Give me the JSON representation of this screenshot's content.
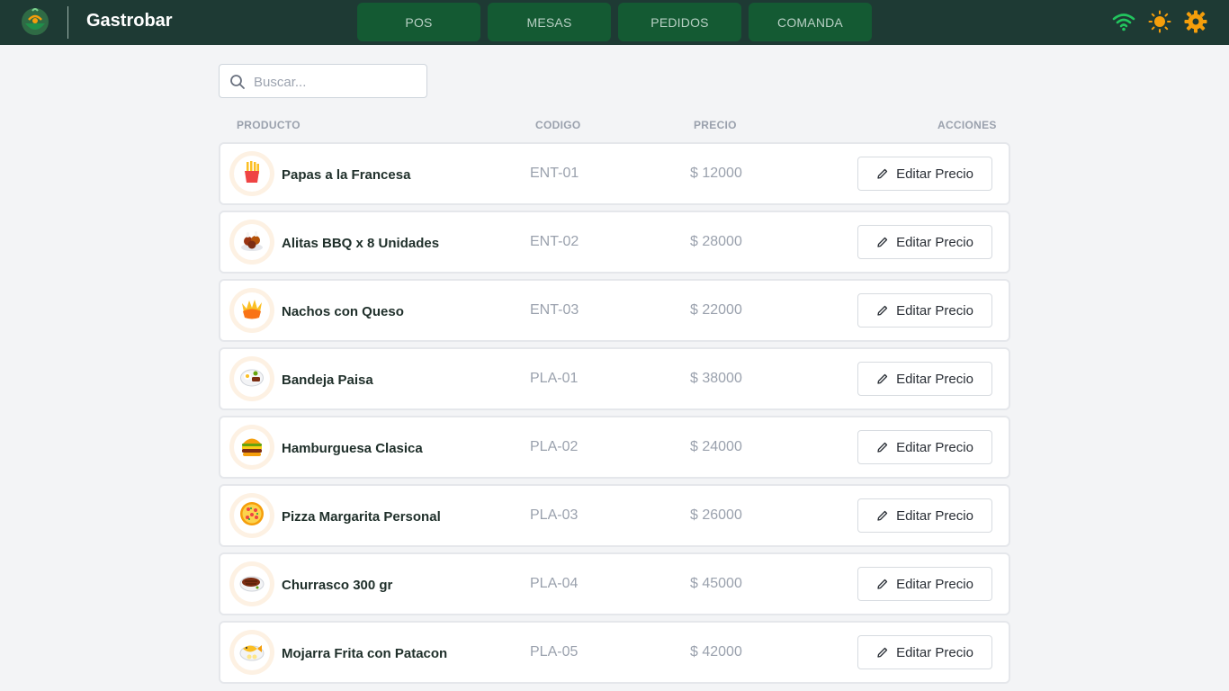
{
  "app": {
    "brand": "Gastrobar",
    "accent": "#1e3a34",
    "nav_color": "#145a33"
  },
  "nav": [
    {
      "label": "POS"
    },
    {
      "label": "MESAS"
    },
    {
      "label": "PEDIDOS"
    },
    {
      "label": "COMANDA"
    }
  ],
  "top_icons": [
    "wifi-icon",
    "sun-icon",
    "gear-icon"
  ],
  "search": {
    "placeholder": "Buscar..."
  },
  "table": {
    "headers": {
      "producto": "PRODUCTO",
      "codigo": "CODIGO",
      "precio": "PRECIO",
      "acciones": "ACCIONES"
    },
    "action_label": "Editar Precio",
    "rows": [
      {
        "icon": "fries-icon",
        "name": "Papas a la Francesa",
        "code": "ENT-01",
        "price": "$ 12000"
      },
      {
        "icon": "chicken-wings-icon",
        "name": "Alitas BBQ x 8 Unidades",
        "code": "ENT-02",
        "price": "$ 28000"
      },
      {
        "icon": "nachos-icon",
        "name": "Nachos con Queso",
        "code": "ENT-03",
        "price": "$ 22000"
      },
      {
        "icon": "platter-icon",
        "name": "Bandeja Paisa",
        "code": "PLA-01",
        "price": "$ 38000"
      },
      {
        "icon": "burger-icon",
        "name": "Hamburguesa Clasica",
        "code": "PLA-02",
        "price": "$ 24000"
      },
      {
        "icon": "pizza-icon",
        "name": "Pizza Margarita Personal",
        "code": "PLA-03",
        "price": "$ 26000"
      },
      {
        "icon": "steak-icon",
        "name": "Churrasco 300 gr",
        "code": "PLA-04",
        "price": "$ 45000"
      },
      {
        "icon": "fish-icon",
        "name": "Mojarra Frita con Patacon",
        "code": "PLA-05",
        "price": "$ 42000"
      }
    ]
  }
}
